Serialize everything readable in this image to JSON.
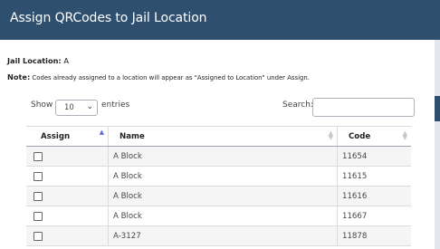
{
  "dialog": {
    "title": "Assign QRCodes to Jail Location"
  },
  "jail_location": {
    "label": "Jail Location:",
    "value": "A"
  },
  "note": {
    "label": "Note:",
    "text": "Codes already assigned to a location will appear as \"Assigned to Location\" under Assign."
  },
  "length": {
    "show": "Show",
    "value": "10",
    "entries": "entries"
  },
  "search": {
    "label": "Search:",
    "value": ""
  },
  "table": {
    "columns": [
      {
        "label": "Assign",
        "sort": "ascending"
      },
      {
        "label": "Name",
        "sort": "none"
      },
      {
        "label": "Code",
        "sort": "none"
      }
    ],
    "rows": [
      {
        "assigned": false,
        "name": "A Block",
        "code": "11654"
      },
      {
        "assigned": false,
        "name": "A Block",
        "code": "11615"
      },
      {
        "assigned": false,
        "name": "A Block",
        "code": "11616"
      },
      {
        "assigned": false,
        "name": "A Block",
        "code": "11667"
      },
      {
        "assigned": false,
        "name": "A-3127",
        "code": "11878"
      }
    ]
  },
  "colors": {
    "header_bg": "#2f4f6f",
    "sort_active": "#5b6be0"
  }
}
